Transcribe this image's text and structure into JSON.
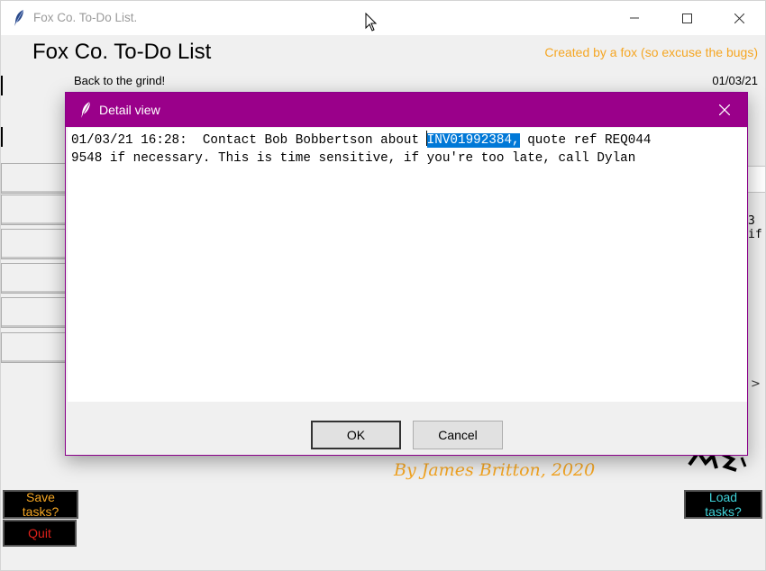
{
  "window": {
    "title": "Fox Co. To-Do List.",
    "icon": "feather-icon",
    "controls": [
      "minimize-icon",
      "maximize-icon",
      "close-icon"
    ]
  },
  "app": {
    "heading": "Fox Co. To-Do List",
    "created_by": "Created by a fox (so excuse the bugs)",
    "motto": "Back to the grind!",
    "date": "01/03/21",
    "partial_right_text": "3 if",
    "right_arrow": ">",
    "byline": "By James Britton, 2020"
  },
  "buttons": {
    "save": "Save tasks?",
    "quit": "Quit",
    "load": "Load tasks?"
  },
  "dialog": {
    "title": "Detail view",
    "icon": "feather-icon",
    "text_before": "01/03/21 16:28:  Contact Bob Bobbertson about ",
    "text_selected": "INV01992384,",
    "text_after_line1": " quote ref REQ044",
    "text_line2": "9548 if necessary. This is time sensitive, if you're too late, call Dylan",
    "ok_label": "OK",
    "cancel_label": "Cancel"
  },
  "colors": {
    "accent_orange": "#f5a623",
    "quit_red": "#e0201a",
    "load_cyan": "#3fd3d9",
    "dialog_titlebar": "#9a008a",
    "selection": "#0078d7"
  }
}
